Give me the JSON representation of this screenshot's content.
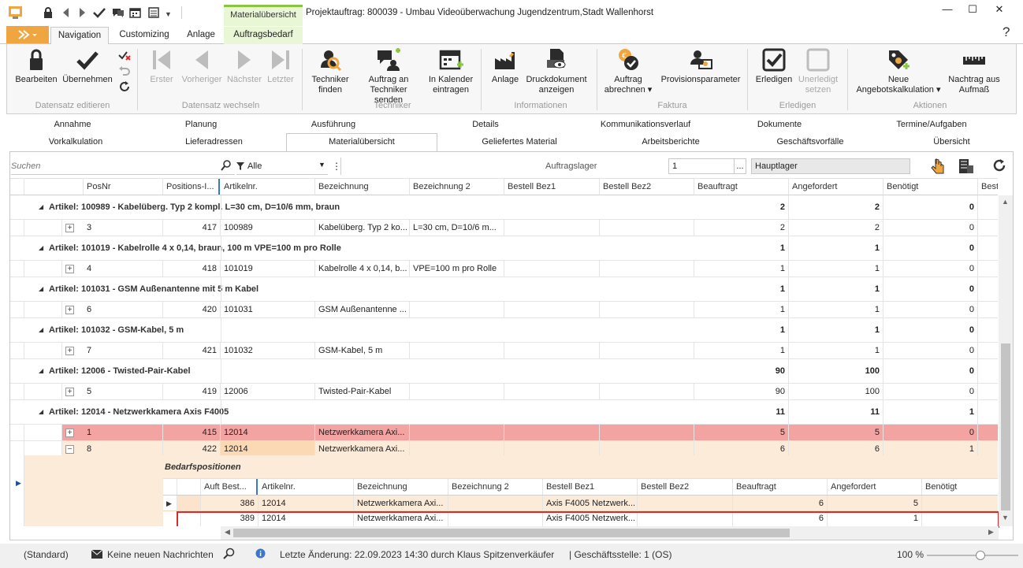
{
  "window": {
    "title": "Projektauftrag: 800039 - Umbau Videoüberwachung Jugendzentrum,Stadt Wallenhorst",
    "context_label": "Materialübersicht",
    "minimize": "—",
    "maximize": "☐",
    "close": "✕"
  },
  "quick_access": [
    "lock-icon",
    "back-icon",
    "forward-icon",
    "check-icon",
    "comment-icon",
    "calendar-icon",
    "list-icon"
  ],
  "ribbon_tabs": [
    {
      "label": "Navigation",
      "active": true
    },
    {
      "label": "Customizing"
    },
    {
      "label": "Anlage"
    },
    {
      "label": "Auftragsbedarf",
      "context": true
    }
  ],
  "ribbon": {
    "groups": [
      "Datensatz editieren",
      "Datensatz wechseln",
      "Techniker",
      "Informationen",
      "Faktura",
      "Erledigen",
      "Aktionen"
    ],
    "buttons": {
      "bearbeiten": "Bearbeiten",
      "uebernehmen": "Übernehmen",
      "erster": "Erster",
      "vorheriger": "Vorheriger",
      "naechster": "Nächster",
      "letzter": "Letzter",
      "techniker_finden_1": "Techniker",
      "techniker_finden_2": "finden",
      "auftrag_techniker_1": "Auftrag an",
      "auftrag_techniker_2": "Techniker senden",
      "kalender_1": "In Kalender",
      "kalender_2": "eintragen",
      "anlage": "Anlage",
      "druck_1": "Druckdokument",
      "druck_2": "anzeigen",
      "abrechnen_1": "Auftrag",
      "abrechnen_2": "abrechnen ▾",
      "provision": "Provisionsparameter",
      "erledigen": "Erledigen",
      "unerledigt_1": "Unerledigt",
      "unerledigt_2": "setzen",
      "angebot_1": "Neue",
      "angebot_2": "Angebotskalkulation ▾",
      "nachtrag_1": "Nachtrag aus",
      "nachtrag_2": "Aufmaß"
    }
  },
  "detail_tabs_row1": [
    "Annahme",
    "Planung",
    "Ausführung",
    "Details",
    "Kommunikationsverlauf",
    "Dokumente",
    "Termine/Aufgaben"
  ],
  "detail_tabs_row2": [
    "Vorkalkulation",
    "Lieferadressen",
    "Materialübersicht",
    "Geliefertes Material",
    "Arbeitsberichte",
    "Geschäftsvorfälle",
    "Übersicht"
  ],
  "filter": {
    "search_placeholder": "Suchen",
    "filter_value": "Alle",
    "lager_label": "Auftragslager",
    "lager_number": "1",
    "lager_name": "Hauptlager",
    "ellipsis": "..."
  },
  "columns": [
    "PosNr",
    "Positions-I...",
    "Artikelnr.",
    "Bezeichnung",
    "Bezeichnung 2",
    "Bestell Bez1",
    "Bestell Bez2",
    "Beauftragt",
    "Angefordert",
    "Benötigt",
    "Best"
  ],
  "groups": [
    {
      "title": "Artikel: 100989 - Kabelüberg. Typ 2 kompl. L=30 cm, D=10/6 mm, braun",
      "beauftragt": "2",
      "angefordert": "2",
      "benoetigt": "0",
      "rows": [
        {
          "pos": "3",
          "posid": "417",
          "art": "100989",
          "bez": "Kabelüberg. Typ 2 ko...",
          "bez2": "L=30 cm, D=10/6 m...",
          "beauftragt": "2",
          "angefordert": "2",
          "benoetigt": "0"
        }
      ]
    },
    {
      "title": "Artikel: 101019 - Kabelrolle 4 x 0,14, braun, 100 m VPE=100 m pro Rolle",
      "beauftragt": "1",
      "angefordert": "1",
      "benoetigt": "0",
      "rows": [
        {
          "pos": "4",
          "posid": "418",
          "art": "101019",
          "bez": "Kabelrolle 4 x 0,14, b...",
          "bez2": "VPE=100 m pro Rolle",
          "beauftragt": "1",
          "angefordert": "1",
          "benoetigt": "0"
        }
      ]
    },
    {
      "title": "Artikel: 101031 - GSM Außenantenne mit 5 m Kabel",
      "beauftragt": "1",
      "angefordert": "1",
      "benoetigt": "0",
      "rows": [
        {
          "pos": "6",
          "posid": "420",
          "art": "101031",
          "bez": "GSM Außenantenne ...",
          "bez2": "",
          "beauftragt": "1",
          "angefordert": "1",
          "benoetigt": "0"
        }
      ]
    },
    {
      "title": "Artikel: 101032 - GSM-Kabel, 5 m",
      "beauftragt": "1",
      "angefordert": "1",
      "benoetigt": "0",
      "rows": [
        {
          "pos": "7",
          "posid": "421",
          "art": "101032",
          "bez": "GSM-Kabel, 5 m",
          "bez2": "",
          "beauftragt": "1",
          "angefordert": "1",
          "benoetigt": "0"
        }
      ]
    },
    {
      "title": "Artikel: 12006 - Twisted-Pair-Kabel",
      "beauftragt": "90",
      "angefordert": "100",
      "benoetigt": "0",
      "rows": [
        {
          "pos": "5",
          "posid": "419",
          "art": "12006",
          "bez": "Twisted-Pair-Kabel",
          "bez2": "",
          "beauftragt": "90",
          "angefordert": "100",
          "benoetigt": "0"
        }
      ]
    },
    {
      "title": "Artikel: 12014 - Netzwerkkamera Axis F4005",
      "beauftragt": "11",
      "angefordert": "11",
      "benoetigt": "1",
      "rows": [
        {
          "pos": "1",
          "posid": "415",
          "art": "12014",
          "bez": "Netzwerkkamera Axi...",
          "bez2": "",
          "beauftragt": "5",
          "angefordert": "5",
          "benoetigt": "0"
        },
        {
          "pos": "8",
          "posid": "422",
          "art": "12014",
          "bez": "Netzwerkkamera Axi...",
          "bez2": "",
          "beauftragt": "6",
          "angefordert": "6",
          "benoetigt": "1"
        }
      ]
    }
  ],
  "sub": {
    "title": "Bedarfspositionen",
    "columns": [
      "Auft Best...",
      "Artikelnr.",
      "Bezeichnung",
      "Bezeichnung 2",
      "Bestell Bez1",
      "Bestell Bez2",
      "Beauftragt",
      "Angefordert",
      "Benötigt"
    ],
    "rows": [
      {
        "auft": "386",
        "art": "12014",
        "bez": "Netzwerkkamera Axi...",
        "bez2": "",
        "bb1": "Axis F4005 Netzwerk...",
        "bb2": "",
        "beauftragt": "6",
        "angefordert": "5",
        "benoetigt": ""
      },
      {
        "auft": "389",
        "art": "12014",
        "bez": "Netzwerkkamera Axi...",
        "bez2": "",
        "bb1": "Axis F4005 Netzwerk...",
        "bb2": "",
        "beauftragt": "6",
        "angefordert": "1",
        "benoetigt": ""
      }
    ]
  },
  "status": {
    "layout": "(Standard)",
    "messages": "Keine neuen Nachrichten",
    "last_change": "Letzte Änderung: 22.09.2023 14:30 durch Klaus Spitzenverkäufer",
    "office": "| Geschäftsstelle:  1 (OS)",
    "zoom": "100 %",
    "zoom_level": 0.6
  },
  "colors": {
    "accent_orange": "#f0a640",
    "context_green": "#8cc63f",
    "row_red": "#f4a3a3",
    "row_peach": "#fdebd9",
    "selection_red": "#d62c2c"
  }
}
